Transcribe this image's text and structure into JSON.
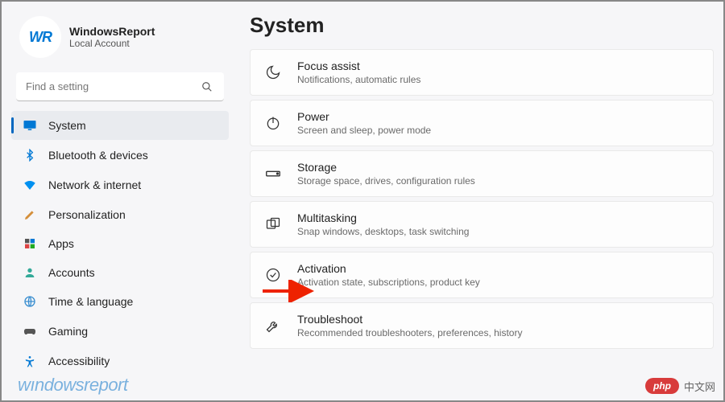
{
  "user": {
    "avatar_text": "WR",
    "name": "WindowsReport",
    "sub": "Local Account"
  },
  "search": {
    "placeholder": "Find a setting"
  },
  "nav": [
    {
      "label": "System"
    },
    {
      "label": "Bluetooth & devices"
    },
    {
      "label": "Network & internet"
    },
    {
      "label": "Personalization"
    },
    {
      "label": "Apps"
    },
    {
      "label": "Accounts"
    },
    {
      "label": "Time & language"
    },
    {
      "label": "Gaming"
    },
    {
      "label": "Accessibility"
    }
  ],
  "main": {
    "title": "System",
    "cards": [
      {
        "title": "Focus assist",
        "sub": "Notifications, automatic rules"
      },
      {
        "title": "Power",
        "sub": "Screen and sleep, power mode"
      },
      {
        "title": "Storage",
        "sub": "Storage space, drives, configuration rules"
      },
      {
        "title": "Multitasking",
        "sub": "Snap windows, desktops, task switching"
      },
      {
        "title": "Activation",
        "sub": "Activation state, subscriptions, product key"
      },
      {
        "title": "Troubleshoot",
        "sub": "Recommended troubleshooters, preferences, history"
      }
    ]
  },
  "watermarks": {
    "wr": "wındowsreport",
    "php": "php",
    "zh": "中文网"
  }
}
